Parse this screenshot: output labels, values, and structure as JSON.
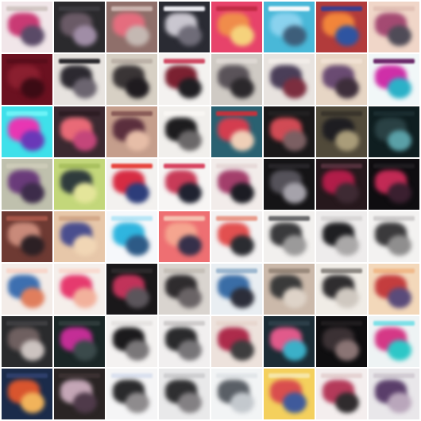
{
  "tiles": [
    {
      "bg": "#f1e6e9",
      "a": "#c93a74",
      "b": "#5a4a67",
      "c": "#d2c7c4"
    },
    {
      "bg": "#2b2a2d",
      "a": "#6a5a66",
      "b": "#a08da6",
      "c": "#3b3a3f"
    },
    {
      "bg": "#8f6f6a",
      "a": "#e56d7e",
      "b": "#c4b8b2",
      "c": "#c9b3ae"
    },
    {
      "bg": "#2a2b33",
      "a": "#c9c6cf",
      "b": "#6f6c78",
      "c": "#eaeaf0"
    },
    {
      "bg": "#e7436a",
      "a": "#f08c4b",
      "b": "#f5d27c",
      "c": "#c22b46"
    },
    {
      "bg": "#49b8d8",
      "a": "#8ad2ee",
      "b": "#3d5e7a",
      "c": "#f6f9fb"
    },
    {
      "bg": "#b23b3b",
      "a": "#f2853a",
      "b": "#2e54a1",
      "c": "#3a3e8e"
    },
    {
      "bg": "#f0d6c8",
      "a": "#a44a72",
      "b": "#4f4b57",
      "c": "#e2c2b6"
    },
    {
      "bg": "#6b1120",
      "a": "#8a1f2f",
      "b": "#3c0b14",
      "c": "#5a0e1b"
    },
    {
      "bg": "#e7e3df",
      "a": "#2c2930",
      "b": "#6c6570",
      "c": "#2b2a2e"
    },
    {
      "bg": "#d7d0c4",
      "a": "#3a3536",
      "b": "#1f1b1f",
      "c": "#bbb1a7"
    },
    {
      "bg": "#f4f2f0",
      "a": "#7b2131",
      "b": "#1f1e22",
      "c": "#d04a64"
    },
    {
      "bg": "#cfcac4",
      "a": "#5a5359",
      "b": "#2b282b",
      "c": "#ded8d3"
    },
    {
      "bg": "#e8e3df",
      "a": "#4a3e58",
      "b": "#7c2e3f",
      "c": "#f1ece8"
    },
    {
      "bg": "#e7d6c5",
      "a": "#6a4b72",
      "b": "#3d2e3a",
      "c": "#f0e0d2"
    },
    {
      "bg": "#f1f7f8",
      "a": "#cf2fa8",
      "b": "#2bb1c8",
      "c": "#6b2a6a"
    },
    {
      "bg": "#3fe0ea",
      "a": "#e836b3",
      "b": "#6a38b8",
      "c": "#6df3f7"
    },
    {
      "bg": "#3b2930",
      "a": "#e96a77",
      "b": "#c4467a",
      "c": "#2e1d24"
    },
    {
      "bg": "#c59e8c",
      "a": "#5b2f3d",
      "b": "#e6bda7",
      "c": "#8a5c58"
    },
    {
      "bg": "#f1efec",
      "a": "#1d1c1e",
      "b": "#6b6869",
      "c": "#f8f6f3"
    },
    {
      "bg": "#2a6171",
      "a": "#d43d4f",
      "b": "#efcfb7",
      "c": "#c2333e"
    },
    {
      "bg": "#1a1819",
      "a": "#d14b55",
      "b": "#7b5f62",
      "c": "#222021"
    },
    {
      "bg": "#514a3a",
      "a": "#1e1d21",
      "b": "#a99c79",
      "c": "#3a352c"
    },
    {
      "bg": "#0f1e20",
      "a": "#2a4144",
      "b": "#5aa0a7",
      "c": "#1a2c2f"
    },
    {
      "bg": "#bfc0ad",
      "a": "#6a3b7a",
      "b": "#3d2c4a",
      "c": "#cdcbb8"
    },
    {
      "bg": "#c3d77a",
      "a": "#2f3b3c",
      "b": "#e4e59a",
      "c": "#a9c160"
    },
    {
      "bg": "#f3f1ef",
      "a": "#d72c43",
      "b": "#2d3d7a",
      "c": "#e7463f"
    },
    {
      "bg": "#f7f5f4",
      "a": "#c83b58",
      "b": "#1f2230",
      "c": "#d84561"
    },
    {
      "bg": "#f2ecea",
      "a": "#a33e6b",
      "b": "#1c1c23",
      "c": "#e7dad9"
    },
    {
      "bg": "#151416",
      "a": "#55525a",
      "b": "#a5a2aa",
      "c": "#262428"
    },
    {
      "bg": "#26181c",
      "a": "#b11d49",
      "b": "#3e2a33",
      "c": "#52303c"
    },
    {
      "bg": "#0f0d10",
      "a": "#c22a55",
      "b": "#3a1f2f",
      "c": "#1e1b1f"
    },
    {
      "bg": "#6e3a33",
      "a": "#c98a7a",
      "b": "#2c2024",
      "c": "#a55548"
    },
    {
      "bg": "#e7c7a9",
      "a": "#4a4e8e",
      "b": "#f1d6b5",
      "c": "#d4a98a"
    },
    {
      "bg": "#f6f8fb",
      "a": "#2fb5df",
      "b": "#2d5a86",
      "c": "#b7e6f6"
    },
    {
      "bg": "#ee6f72",
      "a": "#f5a58f",
      "b": "#36304a",
      "c": "#f5c1b1"
    },
    {
      "bg": "#f4f2f2",
      "a": "#e25050",
      "b": "#2b2c31",
      "c": "#e89a8a"
    },
    {
      "bg": "#f2f0ee",
      "a": "#3a3a3c",
      "b": "#9b9a9a",
      "c": "#6a6a6c"
    },
    {
      "bg": "#eeecec",
      "a": "#1f1f22",
      "b": "#aaa8a8",
      "c": "#d9d7d7"
    },
    {
      "bg": "#f3f2f1",
      "a": "#3b3a3c",
      "b": "#8f8e8e",
      "c": "#d0cece"
    },
    {
      "bg": "#f3ece8",
      "a": "#3d6fb0",
      "b": "#e07e5d",
      "c": "#f7d7cc"
    },
    {
      "bg": "#f5efeb",
      "a": "#e63a6e",
      "b": "#f2b19c",
      "c": "#f8dbd2"
    },
    {
      "bg": "#1a181a",
      "a": "#c1335a",
      "b": "#5b555b",
      "c": "#2b282a"
    },
    {
      "bg": "#d9d4cf",
      "a": "#2f2c2e",
      "b": "#6a6466",
      "c": "#c5bfb8"
    },
    {
      "bg": "#e9eef2",
      "a": "#3a6da6",
      "b": "#2c2e3a",
      "c": "#9db7cf"
    },
    {
      "bg": "#cbb9aa",
      "a": "#3a3a3a",
      "b": "#ded3c8",
      "c": "#9a8a7c"
    },
    {
      "bg": "#f0ece6",
      "a": "#2f2d2f",
      "b": "#cfc8c0",
      "c": "#8e8984"
    },
    {
      "bg": "#f3d8ba",
      "a": "#c43d3e",
      "b": "#5a4b7a",
      "c": "#f0b98a"
    },
    {
      "bg": "#2a2b2d",
      "a": "#6f6060",
      "b": "#ccc3c0",
      "c": "#3e3e41"
    },
    {
      "bg": "#1a2626",
      "a": "#c42e96",
      "b": "#3b4a4b",
      "c": "#2f3b3b"
    },
    {
      "bg": "#f4f2f1",
      "a": "#1b1a1c",
      "b": "#7a7779",
      "c": "#e6e3e2"
    },
    {
      "bg": "#f1efef",
      "a": "#2a2a2c",
      "b": "#777578",
      "c": "#cfcccc"
    },
    {
      "bg": "#ede2dc",
      "a": "#ad2b4b",
      "b": "#3e3d3e",
      "c": "#e7d7cf"
    },
    {
      "bg": "#1c2c35",
      "a": "#e15a8b",
      "b": "#3bb0c8",
      "c": "#2d3e48"
    },
    {
      "bg": "#0f0e10",
      "a": "#3b3134",
      "b": "#8a7474",
      "c": "#1f1c1e"
    },
    {
      "bg": "#eef3f4",
      "a": "#d53886",
      "b": "#2dc7c7",
      "c": "#7ee0e7"
    },
    {
      "bg": "#1b2b4a",
      "a": "#d9552e",
      "b": "#f1b35b",
      "c": "#2e3f6b"
    },
    {
      "bg": "#2a2424",
      "a": "#c4a6b6",
      "b": "#4f3a4a",
      "c": "#3b3132"
    },
    {
      "bg": "#f5f5f6",
      "a": "#2a2a2c",
      "b": "#8e8b8d",
      "c": "#dbe1ef"
    },
    {
      "bg": "#e9e9ea",
      "a": "#2f2f31",
      "b": "#838083",
      "c": "#cfcfd1"
    },
    {
      "bg": "#f2f4f5",
      "a": "#5a5f66",
      "b": "#c3c8cd",
      "c": "#e2e6e9"
    },
    {
      "bg": "#f4d05d",
      "a": "#d94e4e",
      "b": "#3f5a9b",
      "c": "#f6e6a6"
    },
    {
      "bg": "#f4eeee",
      "a": "#b43a5a",
      "b": "#2f2b2d",
      "c": "#e5d3d3"
    },
    {
      "bg": "#e9e7ea",
      "a": "#5a3e6a",
      "b": "#b9a6bb",
      "c": "#d2ccd3"
    }
  ]
}
